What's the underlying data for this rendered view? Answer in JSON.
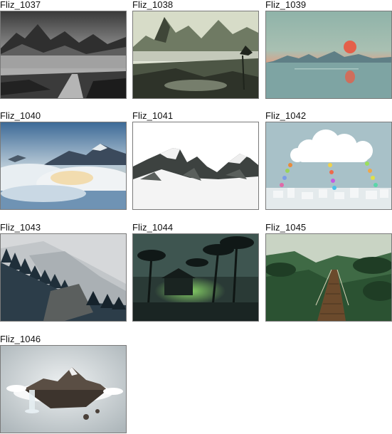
{
  "gallery": {
    "items": [
      {
        "label": "Fliz_1037",
        "scene": "misty-mountain-path-bw"
      },
      {
        "label": "Fliz_1038",
        "scene": "ink-landscape-mountains"
      },
      {
        "label": "Fliz_1039",
        "scene": "red-sun-over-sea"
      },
      {
        "label": "Fliz_1040",
        "scene": "peaks-above-clouds"
      },
      {
        "label": "Fliz_1041",
        "scene": "snowy-mountain-range"
      },
      {
        "label": "Fliz_1042",
        "scene": "cloud-with-colored-drops"
      },
      {
        "label": "Fliz_1043",
        "scene": "snowy-pine-forest-slope"
      },
      {
        "label": "Fliz_1044",
        "scene": "dark-jungle-hut"
      },
      {
        "label": "Fliz_1045",
        "scene": "jungle-rope-bridge"
      },
      {
        "label": "Fliz_1046",
        "scene": "floating-island-waterfall"
      }
    ]
  }
}
